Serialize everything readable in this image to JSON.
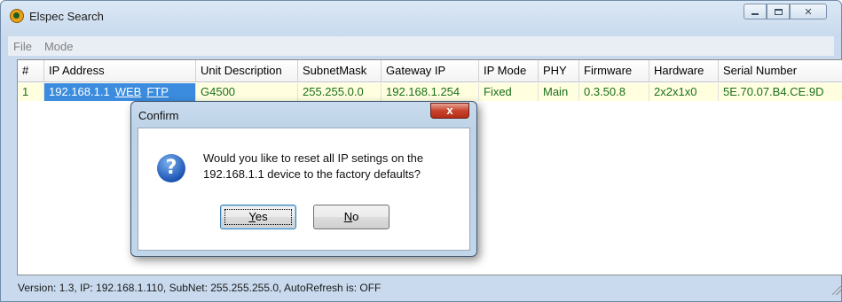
{
  "window": {
    "title": "Elspec Search"
  },
  "menu": [
    "File",
    "Mode"
  ],
  "table": {
    "columns": [
      "#",
      "IP Address",
      "Unit Description",
      "SubnetMask",
      "Gateway IP",
      "IP Mode",
      "PHY",
      "Firmware",
      "Hardware",
      "Serial Number"
    ],
    "rows": [
      {
        "index": "1",
        "ip": "192.168.1.1",
        "web_link": "WEB",
        "ftp_link": "FTP",
        "description": "G4500",
        "subnet": "255.255.0.0",
        "gateway": "192.168.1.254",
        "ip_mode": "Fixed",
        "phy": "Main",
        "firmware": "0.3.50.8",
        "hardware": "2x2x1x0",
        "serial": "5E.70.07.B4.CE.9D"
      }
    ]
  },
  "status": "Version: 1.3, IP: 192.168.1.110, SubNet: 255.255.255.0, AutoRefresh is: OFF",
  "dialog": {
    "title": "Confirm",
    "close_glyph": "x",
    "icon": "question-icon",
    "icon_glyph": "?",
    "message_line1": "Would you like to reset all IP setings on the",
    "message_line2": "192.168.1.1 device to the factory defaults?",
    "yes_mnemonic": "Y",
    "yes_rest": "es",
    "no_mnemonic": "N",
    "no_rest": "o"
  },
  "colors": {
    "selection": "#3b8cde",
    "row_text": "#1a6e1a",
    "row_bg": "#ffffe0"
  }
}
